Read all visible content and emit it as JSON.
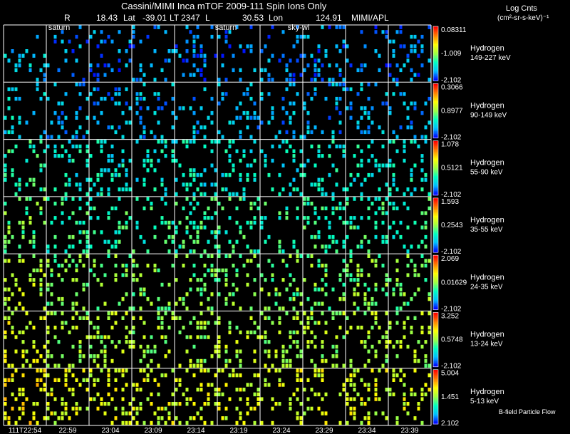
{
  "header": {
    "title": "Cassini/MIMI Inca mTOF  2009-111   Spin   Ions Only",
    "r_label": "R",
    "r_value": "18.43",
    "lat_label": "Lat",
    "lat_value": "-39.01",
    "lt_label": "LT",
    "lt_value": "2347",
    "l_label": "L",
    "l_value": "30.53",
    "lon_label": "Lon",
    "lon_value": "124.91",
    "institution": "MIMI/APL",
    "units_line1": "Log Cnts",
    "units_line2": "(cm²-sr-s-keV)⁻¹"
  },
  "overlay_labels": [
    "saturn",
    "saturn",
    "sky-wl"
  ],
  "footer_note": "B-field Particle Flow",
  "chart_data": {
    "type": "heatmap",
    "title": "Cassini/MIMI Inca mTOF  2009-111   Spin   Ions Only",
    "x_ticks": [
      "111T22:54",
      "22:59",
      "23:04",
      "23:09",
      "23:14",
      "23:19",
      "23:24",
      "23:29",
      "23:34",
      "23:39"
    ],
    "colormap": [
      "#0000ff",
      "#00c0ff",
      "#00ffc0",
      "#a0ff40",
      "#ffff00",
      "#ff8000",
      "#ff0000"
    ],
    "rows": [
      {
        "species": "Hydrogen",
        "energy": "149-227 keV",
        "cbar_max": "0.08311",
        "cbar_mid": "-1.009",
        "cbar_min": "-2.102",
        "level": 0.12
      },
      {
        "species": "Hydrogen",
        "energy": "90-149 keV",
        "cbar_max": "0.3066",
        "cbar_mid": "0.8977",
        "cbar_min": "-2.102",
        "level": 0.16
      },
      {
        "species": "Hydrogen",
        "energy": "55-90 keV",
        "cbar_max": "1.078",
        "cbar_mid": "0.5121",
        "cbar_min": "-2.102",
        "level": 0.28
      },
      {
        "species": "Hydrogen",
        "energy": "35-55 keV",
        "cbar_max": "1.593",
        "cbar_mid": "0.2543",
        "cbar_min": "-2.102",
        "level": 0.36
      },
      {
        "species": "Hydrogen",
        "energy": "24-35 keV",
        "cbar_max": "2.069",
        "cbar_mid": "0.01629",
        "cbar_min": "-2.102",
        "level": 0.46
      },
      {
        "species": "Hydrogen",
        "energy": "13-24 keV",
        "cbar_max": "3.252",
        "cbar_mid": "0.5748",
        "cbar_min": "-2.102",
        "level": 0.52
      },
      {
        "species": "Hydrogen",
        "energy": "5-13 keV",
        "cbar_max": "5.004",
        "cbar_mid": "1.451",
        "cbar_min": "2.102",
        "level": 0.6
      }
    ]
  }
}
